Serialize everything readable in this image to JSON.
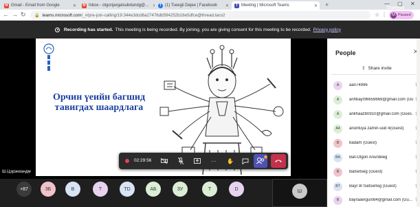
{
  "tabs": [
    {
      "label": "Gmail - Email from Google",
      "icon": "gmail-icon",
      "color": "#ea4335"
    },
    {
      "label": "Inbox - otgonjargalsubdundg@...",
      "icon": "gmail-icon",
      "color": "#ea4335"
    },
    {
      "label": "(1) Tseegii Dejee | Facebook",
      "icon": "facebook-icon",
      "color": "#1877f2"
    },
    {
      "label": "Meeting | Microsoft Teams",
      "icon": "teams-icon",
      "color": "#464eb8"
    }
  ],
  "address": {
    "host": "teams.microsoft.com",
    "path": "/_#/pre-join-calling/19:344e3dcd6a27476db594252b18e5dfce@thread.tacv2"
  },
  "profile": {
    "initial": "M",
    "status": "Paused"
  },
  "banner": {
    "bold": "Recording has started.",
    "text": "This meeting is being recorded. By joining, you are giving consent for this meeting to be recorded.",
    "link": "Privacy policy",
    "dismiss": "Dismiss"
  },
  "slide": {
    "title_line1": "Орчин үеийн багшид",
    "title_line2": "тавигдах шаардлага"
  },
  "presenter_caption": "Ш.Цэрэнхандм",
  "toolbar": {
    "timer": "02:29:56",
    "badge": "8"
  },
  "bottom": {
    "more": "+87",
    "avatars": [
      {
        "initials": "ЗБ",
        "color": "#f0c3ca"
      },
      {
        "initials": "В",
        "color": "#d8e4f5"
      },
      {
        "initials": "Т",
        "color": "#e7d3f0"
      },
      {
        "initials": "TD",
        "color": "#d8e4f5"
      },
      {
        "initials": "АБ",
        "color": "#dbeed5"
      },
      {
        "initials": "ЗУ",
        "color": "#dbeed5"
      },
      {
        "initials": "Т",
        "color": "#dbeed5"
      },
      {
        "initials": "D",
        "color": "#e7d3f0"
      }
    ],
    "self_initial": "Ш"
  },
  "people": {
    "heading": "People",
    "share_label": "Share invite",
    "list": [
      {
        "initials": "A",
        "name": "aari74996",
        "color": "#e7d3f0"
      },
      {
        "initials": "A",
        "name": "anhbayr96659869@gmail.com (Gu...",
        "color": "#dbeed5"
      },
      {
        "initials": "A",
        "name": "ankhaazb0910@gmail.com (Gues...",
        "color": "#dbeed5"
      },
      {
        "initials": "A4",
        "name": "ariuntuya zamin-uud 4(Guest)",
        "color": "#dbeed5"
      },
      {
        "initials": "B",
        "name": "badam (Guest)",
        "color": "#f0c3ca"
      },
      {
        "initials": "BA",
        "name": "Bat-Otgon Ariunbileg",
        "color": "#d8e4f5"
      },
      {
        "initials": "B",
        "name": "Batsetseg (Guest)",
        "color": "#f0c3ca"
      },
      {
        "initials": "BT",
        "name": "Bayr 8r tsetserleg (Guest)",
        "color": "#d8e4f5"
      },
      {
        "initials": "B",
        "name": "bayraaergui084@gmail.com (Gu...",
        "color": "#e7d3f0"
      }
    ]
  }
}
